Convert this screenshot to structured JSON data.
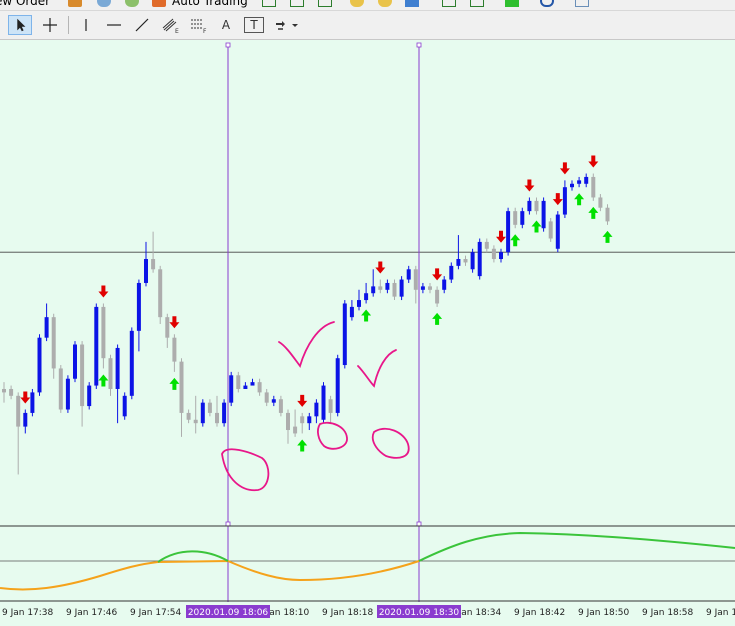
{
  "toolbar_top": {
    "new_order_label": "New Order",
    "auto_trading_label": "Auto Trading"
  },
  "toolbar_tools": [
    {
      "name": "cursor-tool",
      "selected": true
    },
    {
      "name": "crosshair-tool",
      "selected": false
    },
    {
      "name": "vertical-line-tool",
      "selected": false
    },
    {
      "name": "horizontal-line-tool",
      "selected": false
    },
    {
      "name": "trendline-tool",
      "selected": false
    },
    {
      "name": "equidistant-channel-tool",
      "selected": false
    },
    {
      "name": "fibonacci-retracement-tool",
      "selected": false
    },
    {
      "name": "text-tool",
      "label": "A",
      "selected": false
    },
    {
      "name": "text-label-tool",
      "label": "T",
      "selected": false
    },
    {
      "name": "arrows-tool",
      "selected": false
    }
  ],
  "colors": {
    "background": "#e7fbef",
    "bull_candle": "#0c13e6",
    "bear_candle": "#adadad",
    "up_arrow": "#00e000",
    "down_arrow": "#e00000",
    "vertical_lines": "#8a3ccf",
    "annotation": "#e8178a",
    "indicator_up": "#3bc43b",
    "indicator_down": "#f5a21b"
  },
  "time_axis": {
    "labels": [
      "9 Jan 17:38",
      "9 Jan 17:46",
      "9 Jan 17:54",
      "9 Jan 18:10",
      "9 Jan 18:18",
      "9 Jan 18:34",
      "9 Jan 18:42",
      "9 Jan 18:50",
      "9 Jan 18:58",
      "9 Jan 1"
    ],
    "highlighted": [
      "2020.01.09 18:06",
      "2020.01.09 18:30"
    ]
  },
  "chart_data": {
    "type": "candlestick",
    "timeframe_minutes": 1,
    "candles": [
      {
        "bull": false,
        "o": 30,
        "c": 31,
        "h": 33,
        "l": 27
      },
      {
        "bull": false,
        "o": 31,
        "c": 29,
        "h": 32,
        "l": 28
      },
      {
        "bull": false,
        "o": 29,
        "c": 20,
        "h": 30,
        "l": 6
      },
      {
        "bull": true,
        "o": 20,
        "c": 24,
        "h": 25,
        "l": 18
      },
      {
        "bull": true,
        "o": 24,
        "c": 30,
        "h": 31,
        "l": 23
      },
      {
        "bull": true,
        "o": 30,
        "c": 46,
        "h": 47,
        "l": 29
      },
      {
        "bull": true,
        "o": 46,
        "c": 52,
        "h": 56,
        "l": 45
      },
      {
        "bull": false,
        "o": 52,
        "c": 37,
        "h": 53,
        "l": 34
      },
      {
        "bull": false,
        "o": 37,
        "c": 25,
        "h": 38,
        "l": 24
      },
      {
        "bull": true,
        "o": 25,
        "c": 34,
        "h": 35,
        "l": 24
      },
      {
        "bull": true,
        "o": 34,
        "c": 44,
        "h": 45,
        "l": 33
      },
      {
        "bull": false,
        "o": 44,
        "c": 26,
        "h": 45,
        "l": 20
      },
      {
        "bull": true,
        "o": 26,
        "c": 32,
        "h": 33,
        "l": 25
      },
      {
        "bull": true,
        "o": 32,
        "c": 55,
        "h": 56,
        "l": 31
      },
      {
        "bull": false,
        "o": 55,
        "c": 40,
        "h": 56,
        "l": 37
      },
      {
        "bull": false,
        "o": 40,
        "c": 31,
        "h": 41,
        "l": 29
      },
      {
        "bull": true,
        "o": 31,
        "c": 43,
        "h": 44,
        "l": 21
      },
      {
        "bull": true,
        "o": 23,
        "c": 29,
        "h": 30,
        "l": 22
      },
      {
        "bull": true,
        "o": 29,
        "c": 48,
        "h": 49,
        "l": 28
      },
      {
        "bull": true,
        "o": 48,
        "c": 62,
        "h": 63,
        "l": 42
      },
      {
        "bull": true,
        "o": 62,
        "c": 69,
        "h": 74,
        "l": 61
      },
      {
        "bull": false,
        "o": 69,
        "c": 66,
        "h": 77,
        "l": 65
      },
      {
        "bull": false,
        "o": 66,
        "c": 52,
        "h": 67,
        "l": 50
      },
      {
        "bull": false,
        "o": 52,
        "c": 46,
        "h": 53,
        "l": 43
      },
      {
        "bull": false,
        "o": 46,
        "c": 39,
        "h": 47,
        "l": 36
      },
      {
        "bull": false,
        "o": 39,
        "c": 24,
        "h": 40,
        "l": 17
      },
      {
        "bull": false,
        "o": 24,
        "c": 22,
        "h": 25,
        "l": 21
      },
      {
        "bull": false,
        "o": 22,
        "c": 21,
        "h": 29,
        "l": 18
      },
      {
        "bull": true,
        "o": 21,
        "c": 27,
        "h": 28,
        "l": 20
      },
      {
        "bull": false,
        "o": 27,
        "c": 24,
        "h": 28,
        "l": 23
      },
      {
        "bull": false,
        "o": 24,
        "c": 21,
        "h": 29,
        "l": 20
      },
      {
        "bull": true,
        "o": 21,
        "c": 27,
        "h": 28,
        "l": 20
      },
      {
        "bull": true,
        "o": 27,
        "c": 35,
        "h": 36,
        "l": 26
      },
      {
        "bull": false,
        "o": 35,
        "c": 31,
        "h": 36,
        "l": 30
      },
      {
        "bull": true,
        "o": 31,
        "c": 32,
        "h": 33,
        "l": 31
      },
      {
        "bull": true,
        "o": 32,
        "c": 33,
        "h": 34,
        "l": 32
      },
      {
        "bull": false,
        "o": 33,
        "c": 30,
        "h": 34,
        "l": 29
      },
      {
        "bull": false,
        "o": 30,
        "c": 27,
        "h": 31,
        "l": 26
      },
      {
        "bull": true,
        "o": 27,
        "c": 28,
        "h": 29,
        "l": 26
      },
      {
        "bull": false,
        "o": 28,
        "c": 24,
        "h": 29,
        "l": 23
      },
      {
        "bull": false,
        "o": 24,
        "c": 19,
        "h": 25,
        "l": 15
      },
      {
        "bull": false,
        "o": 20,
        "c": 18,
        "h": 25,
        "l": 17
      },
      {
        "bull": false,
        "o": 23,
        "c": 21,
        "h": 24,
        "l": 18
      },
      {
        "bull": true,
        "o": 21,
        "c": 23,
        "h": 24,
        "l": 19
      },
      {
        "bull": true,
        "o": 23,
        "c": 27,
        "h": 28,
        "l": 21
      },
      {
        "bull": true,
        "o": 22,
        "c": 32,
        "h": 33,
        "l": 21
      },
      {
        "bull": false,
        "o": 28,
        "c": 24,
        "h": 29,
        "l": 21
      },
      {
        "bull": true,
        "o": 24,
        "c": 40,
        "h": 41,
        "l": 23
      },
      {
        "bull": true,
        "o": 38,
        "c": 56,
        "h": 57,
        "l": 37
      },
      {
        "bull": true,
        "o": 52,
        "c": 55,
        "h": 57,
        "l": 51
      },
      {
        "bull": true,
        "o": 55,
        "c": 57,
        "h": 60,
        "l": 54
      },
      {
        "bull": true,
        "o": 57,
        "c": 59,
        "h": 62,
        "l": 56
      },
      {
        "bull": true,
        "o": 59,
        "c": 61,
        "h": 66,
        "l": 58
      },
      {
        "bull": false,
        "o": 61,
        "c": 60,
        "h": 63,
        "l": 59
      },
      {
        "bull": true,
        "o": 60,
        "c": 62,
        "h": 63,
        "l": 59
      },
      {
        "bull": false,
        "o": 62,
        "c": 58,
        "h": 63,
        "l": 57
      },
      {
        "bull": true,
        "o": 58,
        "c": 63,
        "h": 64,
        "l": 57
      },
      {
        "bull": true,
        "o": 63,
        "c": 66,
        "h": 67,
        "l": 62
      },
      {
        "bull": false,
        "o": 66,
        "c": 60,
        "h": 67,
        "l": 56
      },
      {
        "bull": true,
        "o": 60,
        "c": 61,
        "h": 62,
        "l": 59
      },
      {
        "bull": false,
        "o": 61,
        "c": 60,
        "h": 62,
        "l": 59
      },
      {
        "bull": false,
        "o": 60,
        "c": 56,
        "h": 61,
        "l": 55
      },
      {
        "bull": true,
        "o": 60,
        "c": 63,
        "h": 64,
        "l": 59
      },
      {
        "bull": true,
        "o": 63,
        "c": 67,
        "h": 68,
        "l": 62
      },
      {
        "bull": true,
        "o": 67,
        "c": 69,
        "h": 76,
        "l": 66
      },
      {
        "bull": false,
        "o": 69,
        "c": 68,
        "h": 70,
        "l": 67
      },
      {
        "bull": true,
        "o": 66,
        "c": 71,
        "h": 72,
        "l": 65
      },
      {
        "bull": true,
        "o": 64,
        "c": 74,
        "h": 75,
        "l": 63
      },
      {
        "bull": false,
        "o": 74,
        "c": 72,
        "h": 75,
        "l": 71
      },
      {
        "bull": false,
        "o": 72,
        "c": 69,
        "h": 73,
        "l": 68
      },
      {
        "bull": true,
        "o": 69,
        "c": 71,
        "h": 72,
        "l": 68
      },
      {
        "bull": true,
        "o": 71,
        "c": 83,
        "h": 84,
        "l": 70
      },
      {
        "bull": false,
        "o": 83,
        "c": 79,
        "h": 84,
        "l": 78
      },
      {
        "bull": true,
        "o": 79,
        "c": 83,
        "h": 84,
        "l": 78
      },
      {
        "bull": true,
        "o": 83,
        "c": 86,
        "h": 87,
        "l": 82
      },
      {
        "bull": false,
        "o": 86,
        "c": 83,
        "h": 87,
        "l": 82
      },
      {
        "bull": true,
        "o": 78,
        "c": 86,
        "h": 87,
        "l": 77
      },
      {
        "bull": false,
        "o": 80,
        "c": 75,
        "h": 81,
        "l": 74
      },
      {
        "bull": true,
        "o": 72,
        "c": 82,
        "h": 83,
        "l": 71
      },
      {
        "bull": true,
        "o": 82,
        "c": 90,
        "h": 92,
        "l": 81
      },
      {
        "bull": true,
        "o": 90,
        "c": 91,
        "h": 92,
        "l": 89
      },
      {
        "bull": true,
        "o": 91,
        "c": 92,
        "h": 93,
        "l": 90
      },
      {
        "bull": true,
        "o": 91,
        "c": 93,
        "h": 94,
        "l": 90
      },
      {
        "bull": false,
        "o": 93,
        "c": 87,
        "h": 94,
        "l": 86
      },
      {
        "bull": false,
        "o": 87,
        "c": 84,
        "h": 88,
        "l": 83
      },
      {
        "bull": false,
        "o": 84,
        "c": 80,
        "h": 85,
        "l": 79
      }
    ],
    "up_arrows": [
      14,
      24,
      42,
      51,
      61,
      72,
      75,
      81,
      83,
      85
    ],
    "down_arrows": [
      3,
      14,
      24,
      42,
      53,
      61,
      70,
      74,
      78,
      79,
      83,
      87,
      90,
      95,
      97,
      103
    ],
    "horizontal_level": 71,
    "vertical_marker_times": [
      "2020.01.09 18:06",
      "2020.01.09 18:30"
    ],
    "indicator_segments": [
      {
        "direction": "down",
        "color": "#f5a21b"
      },
      {
        "direction": "up",
        "color": "#3bc43b"
      }
    ]
  }
}
